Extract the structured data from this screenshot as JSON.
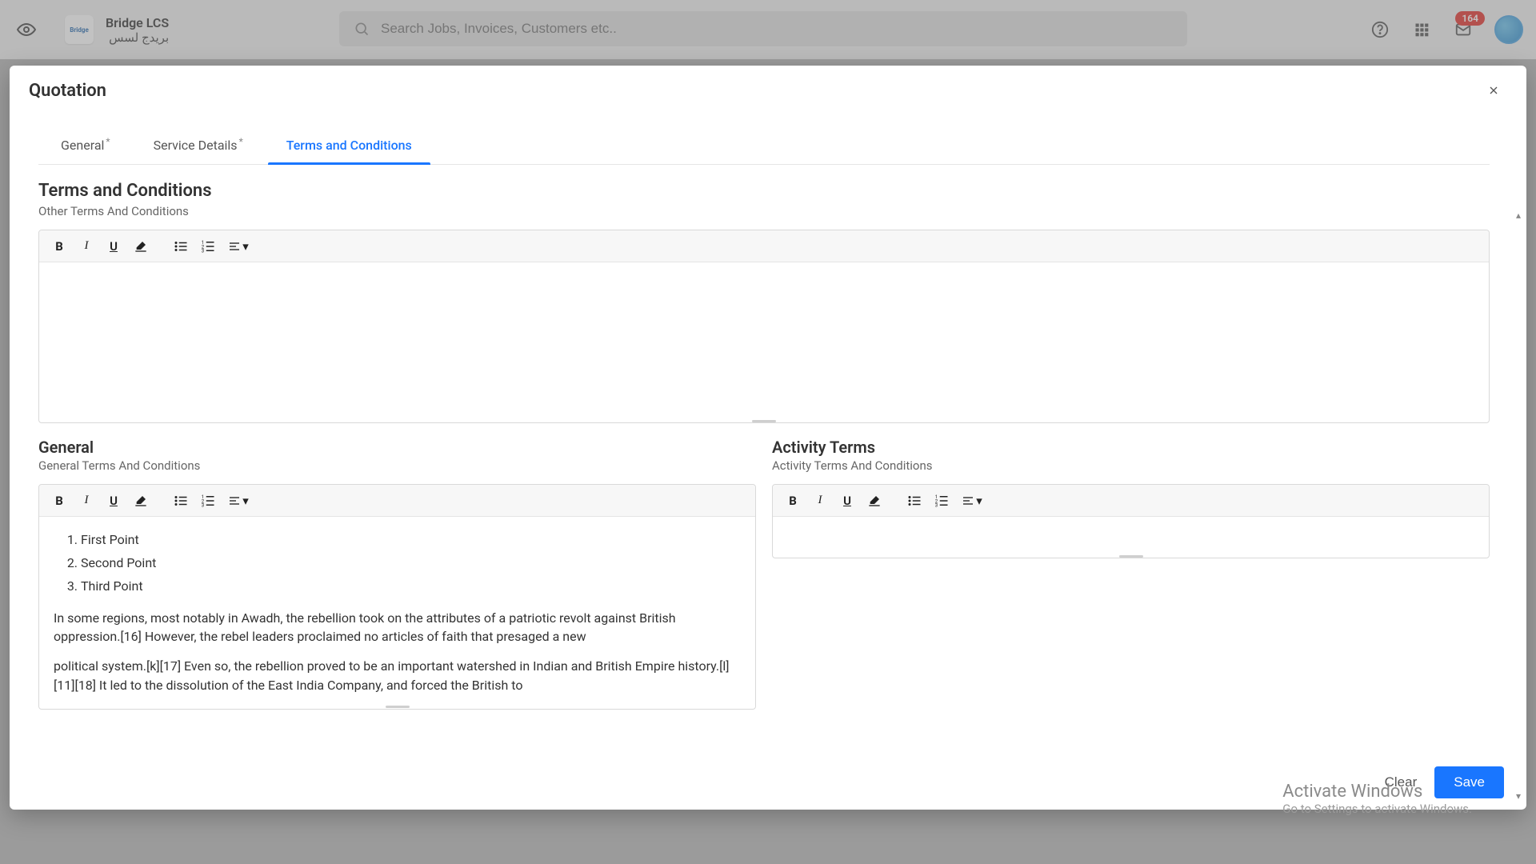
{
  "header": {
    "brand_en": "Bridge LCS",
    "brand_ar": "بريدج لسس",
    "brand_logo_text": "Bridge",
    "search_placeholder": "Search Jobs, Invoices, Customers etc..",
    "notification_badge": "164"
  },
  "modal": {
    "title": "Quotation",
    "tabs": {
      "general": "General",
      "service_details": "Service Details",
      "terms": "Terms and Conditions"
    },
    "section1": {
      "title": "Terms and Conditions",
      "subtitle": "Other Terms And Conditions"
    },
    "general_col": {
      "title": "General",
      "subtitle": "General Terms And Conditions",
      "points": [
        "First Point",
        "Second Point",
        "Third Point"
      ],
      "para1": "In some regions, most notably in Awadh, the rebellion took on the attributes of a patriotic revolt against British oppression.[16] However, the rebel leaders proclaimed no articles of faith that presaged a new",
      "para2": "political system.[k][17] Even so, the rebellion proved to be an important watershed in Indian and British Empire history.[l][11][18] It led to the dissolution of the East India Company, and forced the British to"
    },
    "activity_col": {
      "title": "Activity Terms",
      "subtitle": "Activity Terms And Conditions"
    },
    "footer": {
      "clear": "Clear",
      "save": "Save"
    }
  },
  "watermark": {
    "line1": "Activate Windows",
    "line2": "Go to Settings to activate Windows."
  },
  "icons": {
    "eye": "visibility-icon",
    "help": "help-icon",
    "apps": "apps-grid-icon",
    "mail": "mail-icon",
    "close": "close-icon",
    "bold": "B",
    "italic": "I",
    "underline": "U"
  }
}
